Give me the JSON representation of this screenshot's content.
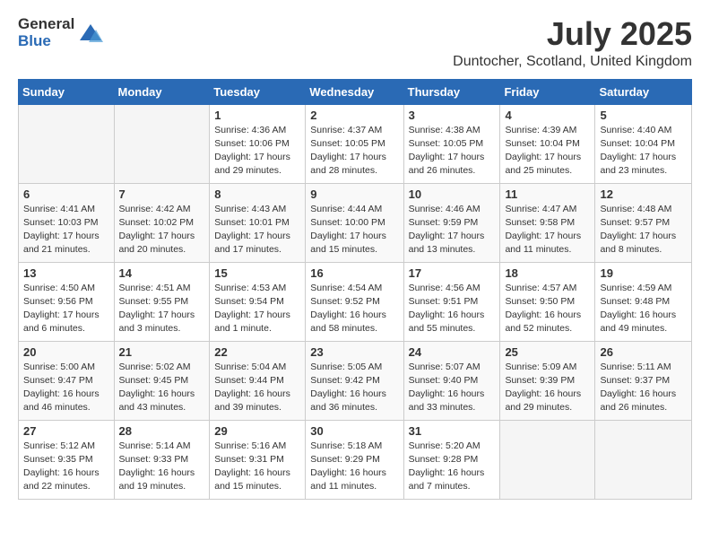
{
  "logo": {
    "general": "General",
    "blue": "Blue"
  },
  "header": {
    "month": "July 2025",
    "location": "Duntocher, Scotland, United Kingdom"
  },
  "days_of_week": [
    "Sunday",
    "Monday",
    "Tuesday",
    "Wednesday",
    "Thursday",
    "Friday",
    "Saturday"
  ],
  "weeks": [
    [
      {
        "day": "",
        "info": ""
      },
      {
        "day": "",
        "info": ""
      },
      {
        "day": "1",
        "info": "Sunrise: 4:36 AM\nSunset: 10:06 PM\nDaylight: 17 hours and 29 minutes."
      },
      {
        "day": "2",
        "info": "Sunrise: 4:37 AM\nSunset: 10:05 PM\nDaylight: 17 hours and 28 minutes."
      },
      {
        "day": "3",
        "info": "Sunrise: 4:38 AM\nSunset: 10:05 PM\nDaylight: 17 hours and 26 minutes."
      },
      {
        "day": "4",
        "info": "Sunrise: 4:39 AM\nSunset: 10:04 PM\nDaylight: 17 hours and 25 minutes."
      },
      {
        "day": "5",
        "info": "Sunrise: 4:40 AM\nSunset: 10:04 PM\nDaylight: 17 hours and 23 minutes."
      }
    ],
    [
      {
        "day": "6",
        "info": "Sunrise: 4:41 AM\nSunset: 10:03 PM\nDaylight: 17 hours and 21 minutes."
      },
      {
        "day": "7",
        "info": "Sunrise: 4:42 AM\nSunset: 10:02 PM\nDaylight: 17 hours and 20 minutes."
      },
      {
        "day": "8",
        "info": "Sunrise: 4:43 AM\nSunset: 10:01 PM\nDaylight: 17 hours and 17 minutes."
      },
      {
        "day": "9",
        "info": "Sunrise: 4:44 AM\nSunset: 10:00 PM\nDaylight: 17 hours and 15 minutes."
      },
      {
        "day": "10",
        "info": "Sunrise: 4:46 AM\nSunset: 9:59 PM\nDaylight: 17 hours and 13 minutes."
      },
      {
        "day": "11",
        "info": "Sunrise: 4:47 AM\nSunset: 9:58 PM\nDaylight: 17 hours and 11 minutes."
      },
      {
        "day": "12",
        "info": "Sunrise: 4:48 AM\nSunset: 9:57 PM\nDaylight: 17 hours and 8 minutes."
      }
    ],
    [
      {
        "day": "13",
        "info": "Sunrise: 4:50 AM\nSunset: 9:56 PM\nDaylight: 17 hours and 6 minutes."
      },
      {
        "day": "14",
        "info": "Sunrise: 4:51 AM\nSunset: 9:55 PM\nDaylight: 17 hours and 3 minutes."
      },
      {
        "day": "15",
        "info": "Sunrise: 4:53 AM\nSunset: 9:54 PM\nDaylight: 17 hours and 1 minute."
      },
      {
        "day": "16",
        "info": "Sunrise: 4:54 AM\nSunset: 9:52 PM\nDaylight: 16 hours and 58 minutes."
      },
      {
        "day": "17",
        "info": "Sunrise: 4:56 AM\nSunset: 9:51 PM\nDaylight: 16 hours and 55 minutes."
      },
      {
        "day": "18",
        "info": "Sunrise: 4:57 AM\nSunset: 9:50 PM\nDaylight: 16 hours and 52 minutes."
      },
      {
        "day": "19",
        "info": "Sunrise: 4:59 AM\nSunset: 9:48 PM\nDaylight: 16 hours and 49 minutes."
      }
    ],
    [
      {
        "day": "20",
        "info": "Sunrise: 5:00 AM\nSunset: 9:47 PM\nDaylight: 16 hours and 46 minutes."
      },
      {
        "day": "21",
        "info": "Sunrise: 5:02 AM\nSunset: 9:45 PM\nDaylight: 16 hours and 43 minutes."
      },
      {
        "day": "22",
        "info": "Sunrise: 5:04 AM\nSunset: 9:44 PM\nDaylight: 16 hours and 39 minutes."
      },
      {
        "day": "23",
        "info": "Sunrise: 5:05 AM\nSunset: 9:42 PM\nDaylight: 16 hours and 36 minutes."
      },
      {
        "day": "24",
        "info": "Sunrise: 5:07 AM\nSunset: 9:40 PM\nDaylight: 16 hours and 33 minutes."
      },
      {
        "day": "25",
        "info": "Sunrise: 5:09 AM\nSunset: 9:39 PM\nDaylight: 16 hours and 29 minutes."
      },
      {
        "day": "26",
        "info": "Sunrise: 5:11 AM\nSunset: 9:37 PM\nDaylight: 16 hours and 26 minutes."
      }
    ],
    [
      {
        "day": "27",
        "info": "Sunrise: 5:12 AM\nSunset: 9:35 PM\nDaylight: 16 hours and 22 minutes."
      },
      {
        "day": "28",
        "info": "Sunrise: 5:14 AM\nSunset: 9:33 PM\nDaylight: 16 hours and 19 minutes."
      },
      {
        "day": "29",
        "info": "Sunrise: 5:16 AM\nSunset: 9:31 PM\nDaylight: 16 hours and 15 minutes."
      },
      {
        "day": "30",
        "info": "Sunrise: 5:18 AM\nSunset: 9:29 PM\nDaylight: 16 hours and 11 minutes."
      },
      {
        "day": "31",
        "info": "Sunrise: 5:20 AM\nSunset: 9:28 PM\nDaylight: 16 hours and 7 minutes."
      },
      {
        "day": "",
        "info": ""
      },
      {
        "day": "",
        "info": ""
      }
    ]
  ]
}
